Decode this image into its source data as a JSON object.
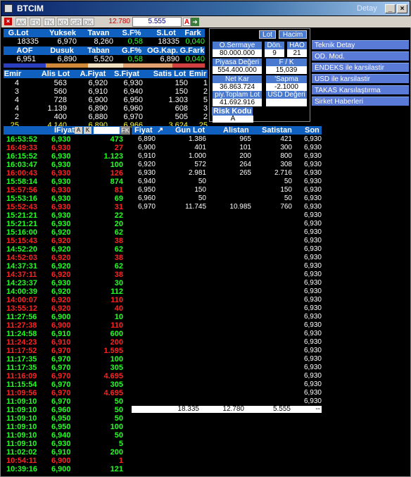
{
  "window": {
    "title": "BTCIM",
    "detay": "Detay"
  },
  "toolbar": {
    "tabs": [
      "AK",
      "FD",
      "TK",
      "KD",
      "GR",
      "DK"
    ],
    "price": "12.780",
    "field": "5.555",
    "a_label": "A"
  },
  "summary": {
    "headers1": [
      "G.Lot",
      "Yuksek",
      "Tavan",
      "S.F%",
      "S.Lot",
      "Fark"
    ],
    "values1": [
      "18335",
      "6,970",
      "8,260",
      "0,58",
      "18335",
      "0,040"
    ],
    "headers2": [
      "AOF",
      "Dusuk",
      "Taban",
      "G.F%",
      "OG.Kap.",
      "G.Fark"
    ],
    "values2": [
      "6,951",
      "6,890",
      "5,520",
      "0,58",
      "6,890",
      "0,040"
    ]
  },
  "depth_top": {
    "headers": [
      "Emir",
      "Alis Lot",
      "A.Fiyat",
      "S.Fiyat",
      "Satis Lot",
      "Emir"
    ],
    "rows": [
      [
        "4",
        "563",
        "6,920",
        "6,930",
        "150",
        "1"
      ],
      [
        "3",
        "560",
        "6,910",
        "6,940",
        "150",
        "2"
      ],
      [
        "4",
        "728",
        "6,900",
        "6,950",
        "1.303",
        "5"
      ],
      [
        "4",
        "1.139",
        "6,890",
        "6,960",
        "608",
        "3"
      ],
      [
        "2",
        "400",
        "6,880",
        "6,970",
        "505",
        "2"
      ]
    ],
    "total": [
      "25",
      "4.140",
      "6,890",
      "6,966",
      "3.624",
      "25"
    ]
  },
  "panel": {
    "btn_lot": "Lot",
    "btn_hacim": "Hacim",
    "o_sermaye_lbl": "O.Sermaye",
    "o_sermaye": "80.000.000",
    "don_lbl": "Dön.",
    "don": "9",
    "hao_lbl": "HAO",
    "hao": "21",
    "piyasa_lbl": "Piyasa Değeri",
    "piyasa": "554.400.000",
    "fk_lbl": "F / K",
    "fk": "15,039",
    "netkar_lbl": "Net Kar",
    "netkar": "36.863.724",
    "sapma_lbl": "'Sapma",
    "sapma": "-2.1000",
    "toplam_lbl": "piy.Toplam Lot",
    "toplam": "41.692.916",
    "usd_lbl": "USD Değeri",
    "risk_lbl": "Risk Kodu",
    "risk": "A"
  },
  "menu": [
    "Teknik Detay",
    "OD. Mod.",
    "ENDEKS ile karsilastir",
    "USD ile karsilastir",
    "TAKAS Karsılaştırma",
    "Sirket Haberleri"
  ],
  "trades_header": {
    "label": "İFiyat",
    "a": "A",
    "k": "K",
    "fk": "FK"
  },
  "trades": [
    [
      "16:53:52",
      "6,930",
      "473",
      "up"
    ],
    [
      "16:49:33",
      "6,930",
      "27",
      "dn"
    ],
    [
      "16:15:52",
      "6,930",
      "1.123",
      "up"
    ],
    [
      "16:03:47",
      "6,930",
      "100",
      "up"
    ],
    [
      "16:00:43",
      "6,930",
      "126",
      "dn"
    ],
    [
      "15:58:14",
      "6,930",
      "874",
      "up"
    ],
    [
      "15:57:56",
      "6,930",
      "81",
      "dn"
    ],
    [
      "15:53:16",
      "6,930",
      "69",
      "up"
    ],
    [
      "15:52:43",
      "6,930",
      "31",
      "dn"
    ],
    [
      "15:21:21",
      "6,930",
      "22",
      "up"
    ],
    [
      "15:21:21",
      "6,930",
      "20",
      "up"
    ],
    [
      "15:16:00",
      "6,920",
      "62",
      "up"
    ],
    [
      "15:15:43",
      "6,920",
      "38",
      "dn"
    ],
    [
      "14:52:20",
      "6,920",
      "62",
      "up"
    ],
    [
      "14:52:03",
      "6,920",
      "38",
      "dn"
    ],
    [
      "14:37:31",
      "6,920",
      "62",
      "up"
    ],
    [
      "14:37:11",
      "6,920",
      "38",
      "dn"
    ],
    [
      "14:23:37",
      "6,930",
      "30",
      "up"
    ],
    [
      "14:00:39",
      "6,920",
      "112",
      "up"
    ],
    [
      "14:00:07",
      "6,920",
      "110",
      "dn"
    ],
    [
      "13:55:12",
      "6,920",
      "40",
      "dn"
    ],
    [
      "11:27:56",
      "6,900",
      "10",
      "up"
    ],
    [
      "11:27:38",
      "6,900",
      "110",
      "dn"
    ],
    [
      "11:24:58",
      "6,910",
      "600",
      "up"
    ],
    [
      "11:24:23",
      "6,910",
      "200",
      "dn"
    ],
    [
      "11:17:52",
      "6,970",
      "1.595",
      "dn"
    ],
    [
      "11:17:35",
      "6,970",
      "100",
      "up"
    ],
    [
      "11:17:35",
      "6,970",
      "305",
      "up"
    ],
    [
      "11:16:09",
      "6,970",
      "4.695",
      "dn"
    ],
    [
      "11:15:54",
      "6,970",
      "305",
      "up"
    ],
    [
      "11:09:56",
      "6,970",
      "4.695",
      "dn"
    ],
    [
      "11:09:10",
      "6,970",
      "50",
      "up"
    ],
    [
      "11:09:10",
      "6,960",
      "50",
      "up"
    ],
    [
      "11:09:10",
      "6,950",
      "50",
      "up"
    ],
    [
      "11:09:10",
      "6,950",
      "100",
      "up"
    ],
    [
      "11:09:10",
      "6,940",
      "50",
      "up"
    ],
    [
      "11:09:10",
      "6,930",
      "5",
      "up"
    ],
    [
      "11:02:02",
      "6,910",
      "200",
      "up"
    ],
    [
      "10:54:11",
      "6,900",
      "1",
      "dn"
    ],
    [
      "10:39:16",
      "6,900",
      "121",
      "up"
    ]
  ],
  "depth_header": [
    "Fiyat",
    "Gun Lot",
    "Alistan",
    "Satistan",
    "Son"
  ],
  "depth_rows": [
    [
      "6,890",
      "1.386",
      "965",
      "421",
      "6,930"
    ],
    [
      "6,900",
      "401",
      "101",
      "300",
      "6,930"
    ],
    [
      "6,910",
      "1.000",
      "200",
      "800",
      "6,930"
    ],
    [
      "6,920",
      "572",
      "264",
      "308",
      "6,930"
    ],
    [
      "6,930",
      "2.981",
      "265",
      "2.716",
      "6,930"
    ],
    [
      "6,940",
      "50",
      "",
      "50",
      "6,930"
    ],
    [
      "6,950",
      "150",
      "",
      "150",
      "6,930"
    ],
    [
      "6,960",
      "50",
      "",
      "50",
      "6,930"
    ],
    [
      "6,970",
      "11.745",
      "10.985",
      "760",
      "6,930"
    ]
  ],
  "son_extra": "6,930",
  "depth_total": [
    "18.335",
    "12.780",
    "5.555",
    "--"
  ]
}
